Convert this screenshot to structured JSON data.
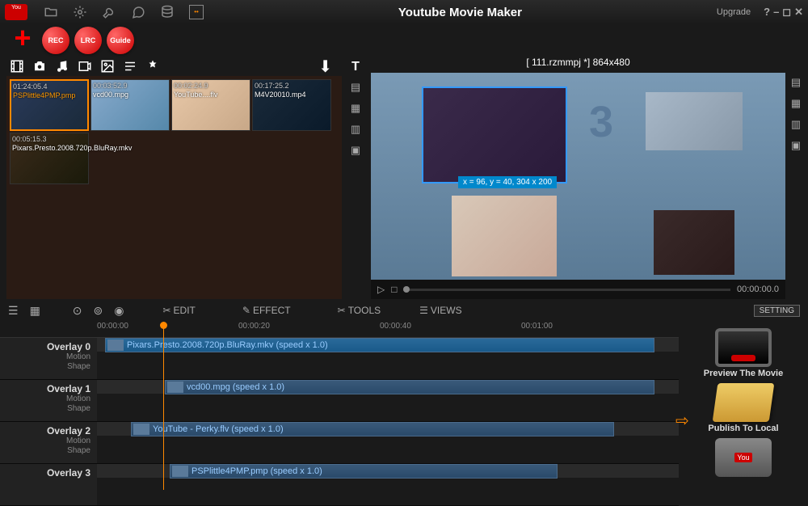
{
  "app_title": "Youtube Movie Maker",
  "upgrade_label": "Upgrade",
  "action_buttons": {
    "rec": "REC",
    "lrc": "LRC",
    "guide": "Guide"
  },
  "media_items": [
    {
      "duration": "01:24:05.4",
      "name": "PSPlittle4PMP.pmp",
      "selected": true
    },
    {
      "duration": "00:03:52.9",
      "name": "vcd00.mpg",
      "selected": false
    },
    {
      "duration": "00:02:24.9",
      "name": "YouTube....flv",
      "selected": false
    },
    {
      "duration": "00:17:25.2",
      "name": "M4V20010.mp4",
      "selected": false
    },
    {
      "duration": "00:05:15.3",
      "name": "Pixars.Presto.2008.720p.BluRay.mkv",
      "selected": false
    }
  ],
  "preview": {
    "title": "[ 111.rzmmpj *]   864x480",
    "coords": "x = 96, y = 40, 304 x 200",
    "timecode": "00:00:00.0"
  },
  "toolbar": {
    "edit": "EDIT",
    "effect": "EFFECT",
    "tools": "TOOLS",
    "views": "VIEWS",
    "setting": "SETTING"
  },
  "timeline": {
    "ticks": [
      "00:00:00",
      "00:00:20",
      "00:00:40",
      "00:01:00"
    ],
    "tracks": [
      {
        "name": "Overlay 0",
        "sub1": "Motion",
        "sub2": "Shape",
        "clip": "Pixars.Presto.2008.720p.BluRay.mkv  (speed x 1.0)"
      },
      {
        "name": "Overlay 1",
        "sub1": "Motion",
        "sub2": "Shape",
        "clip": "vcd00.mpg  (speed x 1.0)"
      },
      {
        "name": "Overlay 2",
        "sub1": "Motion",
        "sub2": "Shape",
        "clip": "YouTube - Perky.flv  (speed x 1.0)"
      },
      {
        "name": "Overlay 3",
        "sub1": "",
        "sub2": "",
        "clip": "PSPlittle4PMP.pmp  (speed x 1.0)"
      }
    ]
  },
  "side": {
    "preview": "Preview The Movie",
    "publish": "Publish To Local"
  }
}
